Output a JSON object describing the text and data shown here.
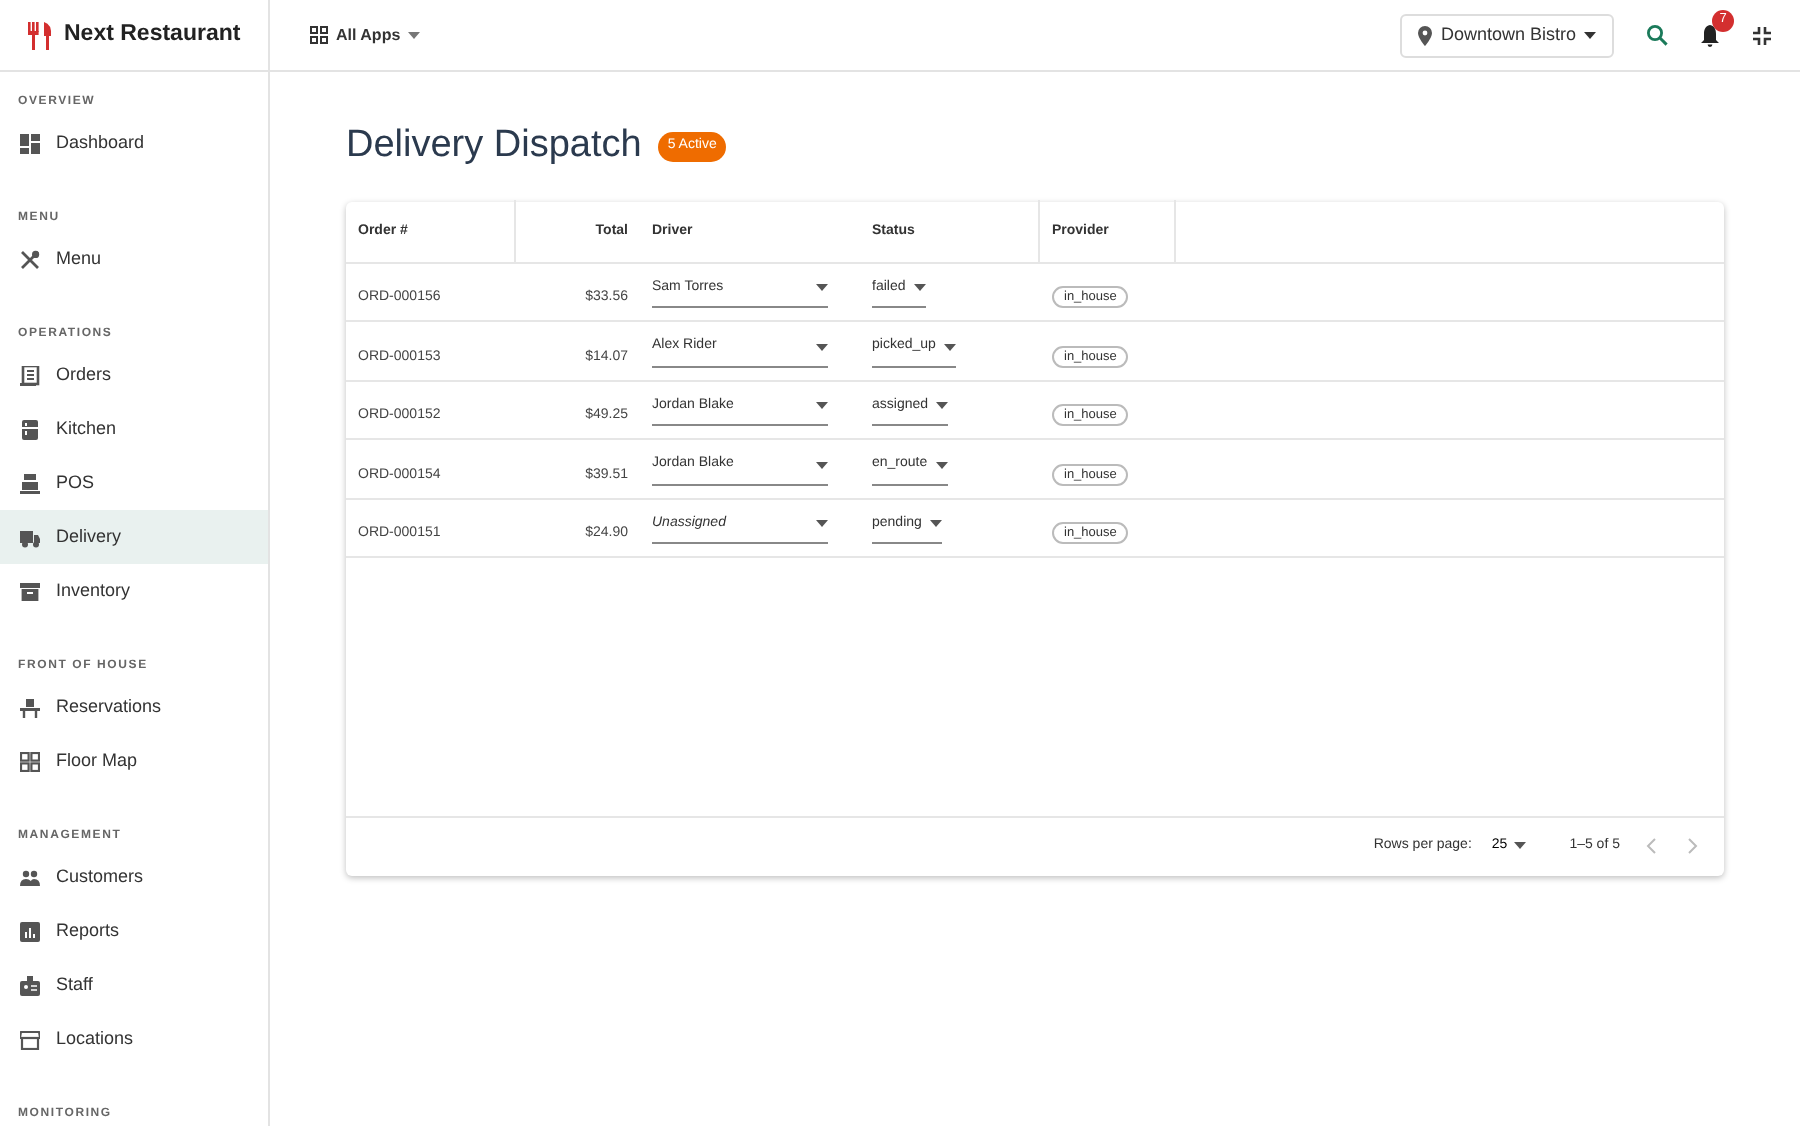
{
  "brand": {
    "name": "Next Restaurant"
  },
  "apps_menu": {
    "label": "All Apps"
  },
  "location_picker": {
    "label": "Downtown Bistro"
  },
  "notifications": {
    "count": "7"
  },
  "sidebar": {
    "sections": [
      {
        "title": "OVERVIEW",
        "items": [
          {
            "label": "Dashboard",
            "selected": false
          }
        ]
      },
      {
        "title": "MENU",
        "items": [
          {
            "label": "Menu",
            "selected": false
          }
        ]
      },
      {
        "title": "OPERATIONS",
        "items": [
          {
            "label": "Orders",
            "selected": false
          },
          {
            "label": "Kitchen",
            "selected": false
          },
          {
            "label": "POS",
            "selected": false
          },
          {
            "label": "Delivery",
            "selected": true
          },
          {
            "label": "Inventory",
            "selected": false
          }
        ]
      },
      {
        "title": "FRONT OF HOUSE",
        "items": [
          {
            "label": "Reservations",
            "selected": false
          },
          {
            "label": "Floor Map",
            "selected": false
          }
        ]
      },
      {
        "title": "MANAGEMENT",
        "items": [
          {
            "label": "Customers",
            "selected": false
          },
          {
            "label": "Reports",
            "selected": false
          },
          {
            "label": "Staff",
            "selected": false
          },
          {
            "label": "Locations",
            "selected": false
          }
        ]
      },
      {
        "title": "MONITORING"
      }
    ]
  },
  "page": {
    "title": "Delivery Dispatch",
    "badge": "5 Active"
  },
  "table": {
    "columns": [
      "Order #",
      "Total",
      "Driver",
      "Status",
      "Provider"
    ],
    "rows": [
      {
        "order": "ORD-000156",
        "total": "$33.56",
        "driver": "Sam Torres",
        "unassigned": false,
        "status": "failed",
        "provider": "in_house"
      },
      {
        "order": "ORD-000153",
        "total": "$14.07",
        "driver": "Alex Rider",
        "unassigned": false,
        "status": "picked_up",
        "provider": "in_house"
      },
      {
        "order": "ORD-000152",
        "total": "$49.25",
        "driver": "Jordan Blake",
        "unassigned": false,
        "status": "assigned",
        "provider": "in_house"
      },
      {
        "order": "ORD-000154",
        "total": "$39.51",
        "driver": "Jordan Blake",
        "unassigned": false,
        "status": "en_route",
        "provider": "in_house"
      },
      {
        "order": "ORD-000151",
        "total": "$24.90",
        "driver": "Unassigned",
        "unassigned": true,
        "status": "pending",
        "provider": "in_house"
      }
    ]
  },
  "pagination": {
    "rows_per_page_label": "Rows per page:",
    "rows_per_page": "25",
    "range": "1–5 of 5",
    "prev_disabled": true,
    "next_disabled": true
  }
}
